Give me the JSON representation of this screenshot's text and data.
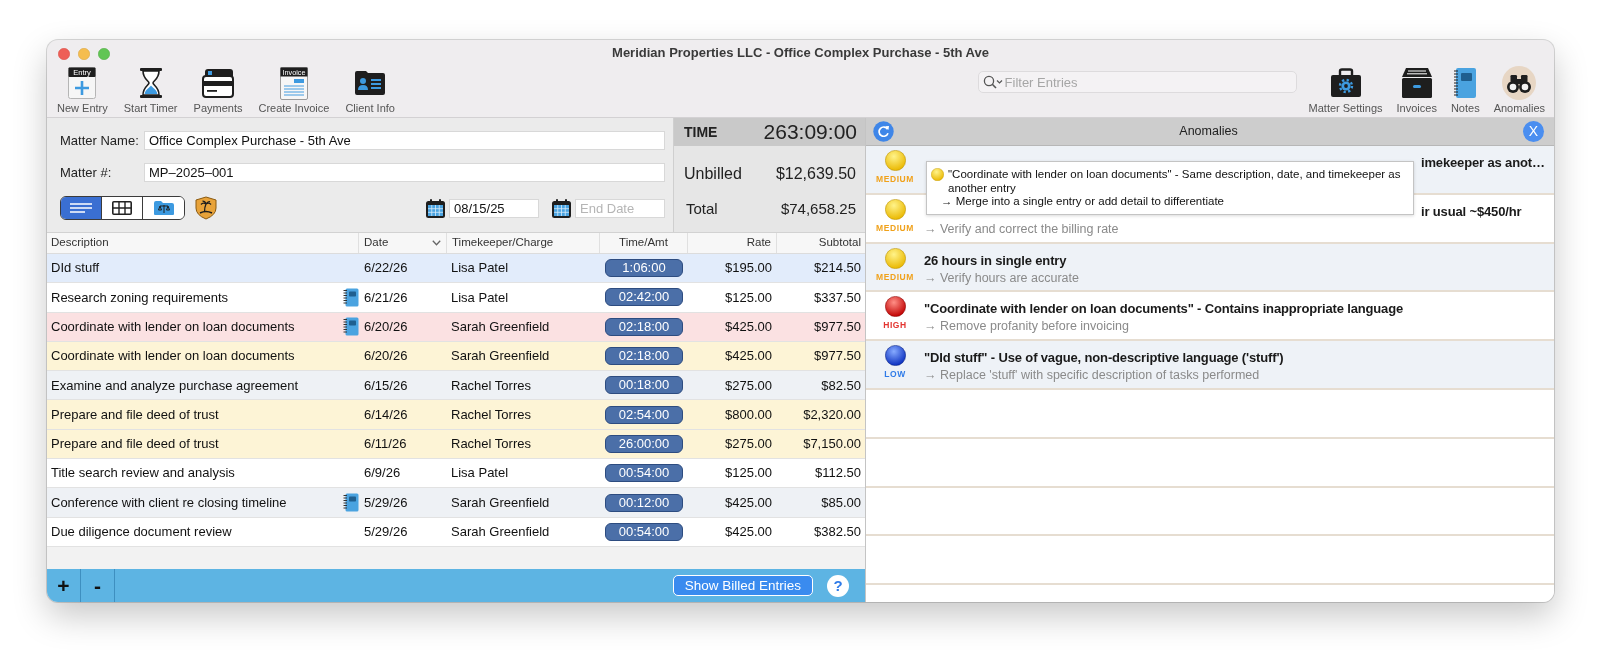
{
  "window": {
    "title": "Meridian Properties LLC - Office Complex Purchase - 5th Ave"
  },
  "toolbar": {
    "left": [
      {
        "kind": "new-entry",
        "label": "New Entry",
        "icon_caption": "Entry"
      },
      {
        "kind": "timer",
        "label": "Start Timer"
      },
      {
        "kind": "payments",
        "label": "Payments"
      },
      {
        "kind": "invoice",
        "label": "Create Invoice",
        "icon_caption": "Invoice"
      },
      {
        "kind": "client",
        "label": "Client Info"
      }
    ],
    "filter": {
      "placeholder": "Filter Entries"
    },
    "right": [
      {
        "kind": "settings",
        "label": "Matter Settings",
        "selected": false
      },
      {
        "kind": "invoices",
        "label": "Invoices",
        "selected": false
      },
      {
        "kind": "notes",
        "label": "Notes",
        "selected": false
      },
      {
        "kind": "anomalies",
        "label": "Anomalies",
        "selected": true
      }
    ]
  },
  "matter": {
    "name_label": "Matter Name:",
    "name": "Office Complex Purchase - 5th Ave",
    "number_label": "Matter #:",
    "number": "MP–2025–001",
    "view_modes": [
      {
        "kind": "list",
        "selected": true
      },
      {
        "kind": "grid",
        "selected": false
      },
      {
        "kind": "folder",
        "selected": false
      }
    ],
    "start_date": {
      "value": "08/15/25"
    },
    "end_date": {
      "placeholder": "End Date"
    }
  },
  "time_panel": {
    "label": "TIME",
    "value": "263:09:00",
    "unbilled_label": "Unbilled",
    "unbilled": "$12,639.50",
    "total_label": "Total",
    "total": "$74,658.25"
  },
  "table": {
    "columns": [
      {
        "label": "Description",
        "sorted": false
      },
      {
        "label": "Date",
        "sorted": true
      },
      {
        "label": "Timekeeper/Charge",
        "sorted": false
      },
      {
        "label": "Time/Amt",
        "sorted": false
      },
      {
        "label": "Rate",
        "sorted": false
      },
      {
        "label": "Subtotal",
        "sorted": false
      }
    ],
    "rows": [
      {
        "description": "DId stuff",
        "note": false,
        "date": "6/22/26",
        "timekeeper": "Lisa Patel",
        "time": "1:06:00",
        "rate": "$195.00",
        "subtotal": "$214.50",
        "color": "#e2ecfb"
      },
      {
        "description": "Research zoning requirements",
        "note": true,
        "date": "6/21/26",
        "timekeeper": "Lisa Patel",
        "time": "02:42:00",
        "rate": "$125.00",
        "subtotal": "$337.50"
      },
      {
        "description": "Coordinate with lender on loan documents",
        "note": true,
        "date": "6/20/26",
        "timekeeper": "Sarah Greenfield",
        "time": "02:18:00",
        "rate": "$425.00",
        "subtotal": "$977.50",
        "color": "#fbe1e2"
      },
      {
        "description": "Coordinate with lender on loan documents",
        "note": false,
        "date": "6/20/26",
        "timekeeper": "Sarah Greenfield",
        "time": "02:18:00",
        "rate": "$425.00",
        "subtotal": "$977.50",
        "color": "#fdf4d6"
      },
      {
        "description": "Examine and analyze purchase agreement",
        "note": false,
        "date": "6/15/26",
        "timekeeper": "Rachel Torres",
        "time": "00:18:00",
        "rate": "$275.00",
        "subtotal": "$82.50"
      },
      {
        "description": "Prepare and file deed of trust",
        "note": false,
        "date": "6/14/26",
        "timekeeper": "Rachel Torres",
        "time": "02:54:00",
        "rate": "$800.00",
        "subtotal": "$2,320.00",
        "color": "#fdf4d6"
      },
      {
        "description": "Prepare and file deed of trust",
        "note": false,
        "date": "6/11/26",
        "timekeeper": "Rachel Torres",
        "time": "26:00:00",
        "rate": "$275.00",
        "subtotal": "$7,150.00",
        "color": "#fdf4d6"
      },
      {
        "description": "Title search review and analysis",
        "note": false,
        "date": "6/9/26",
        "timekeeper": "Lisa Patel",
        "time": "00:54:00",
        "rate": "$125.00",
        "subtotal": "$112.50"
      },
      {
        "description": "Conference with client re closing timeline",
        "note": true,
        "date": "5/29/26",
        "timekeeper": "Sarah Greenfield",
        "time": "00:12:00",
        "rate": "$425.00",
        "subtotal": "$85.00"
      },
      {
        "description": "Due diligence document review",
        "note": false,
        "date": "5/29/26",
        "timekeeper": "Sarah Greenfield",
        "time": "00:54:00",
        "rate": "$425.00",
        "subtotal": "$382.50"
      }
    ]
  },
  "bottom_bar": {
    "add": "+",
    "remove": "-",
    "show_billed": "Show Billed Entries",
    "help": "?"
  },
  "anomalies": {
    "title": "Anomalies",
    "close": "X",
    "items": [
      {
        "kind": "medium",
        "level_label": "MEDIUM",
        "title": "imekeeper as anot…"
      },
      {
        "kind": "medium",
        "level_label": "MEDIUM",
        "title": "ir usual ~$450/hr",
        "action": "→ Verify and correct the billing rate"
      },
      {
        "kind": "medium",
        "level_label": "MEDIUM",
        "title": "26 hours in single entry",
        "action": "→ Verify hours are accurate"
      },
      {
        "kind": "high",
        "level_label": "HIGH",
        "title": "\"Coordinate with lender on loan documents\" - Contains inappropriate language",
        "action": "→ Remove profanity before invoicing"
      },
      {
        "kind": "low",
        "level_label": "LOW",
        "title": "\"DId stuff\" - Use of vague, non-descriptive language ('stuff')",
        "action": "→ Replace 'stuff' with specific description of tasks performed"
      }
    ],
    "tooltip": {
      "kind": "medium",
      "text": "\"Coordinate with lender on loan documents\" - Same description, date, and timekeeper as another entry",
      "action": "→ Merge into a single entry or add detail to differentiate"
    }
  }
}
